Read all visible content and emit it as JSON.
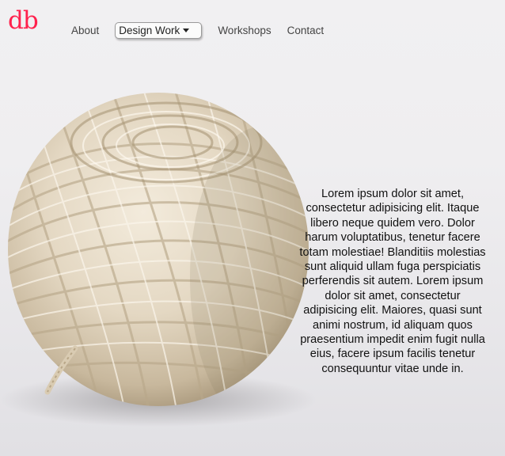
{
  "logo": {
    "text": "db",
    "color": "#ff214d"
  },
  "nav": {
    "items": [
      {
        "label": "About"
      },
      {
        "label": "Design Work"
      },
      {
        "label": "Workshops"
      },
      {
        "label": "Contact"
      }
    ],
    "dropdown_icon": "caret-down-icon"
  },
  "hero": {
    "image": "yarn-ball"
  },
  "content": {
    "paragraph": "Lorem ipsum dolor sit amet, consectetur adipisicing elit. Itaque libero neque quidem vero. Dolor harum voluptatibus, tenetur facere totam molestiae! Blanditiis molestias sunt aliquid ullam fuga perspiciatis perferendis sit autem. Lorem ipsum dolor sit amet, consectetur adipisicing elit. Maiores, quasi sunt animi nostrum, id aliquam quos praesentium impedit enim fugit nulla eius, facere ipsum facilis tenetur consequuntur vitae unde in."
  }
}
